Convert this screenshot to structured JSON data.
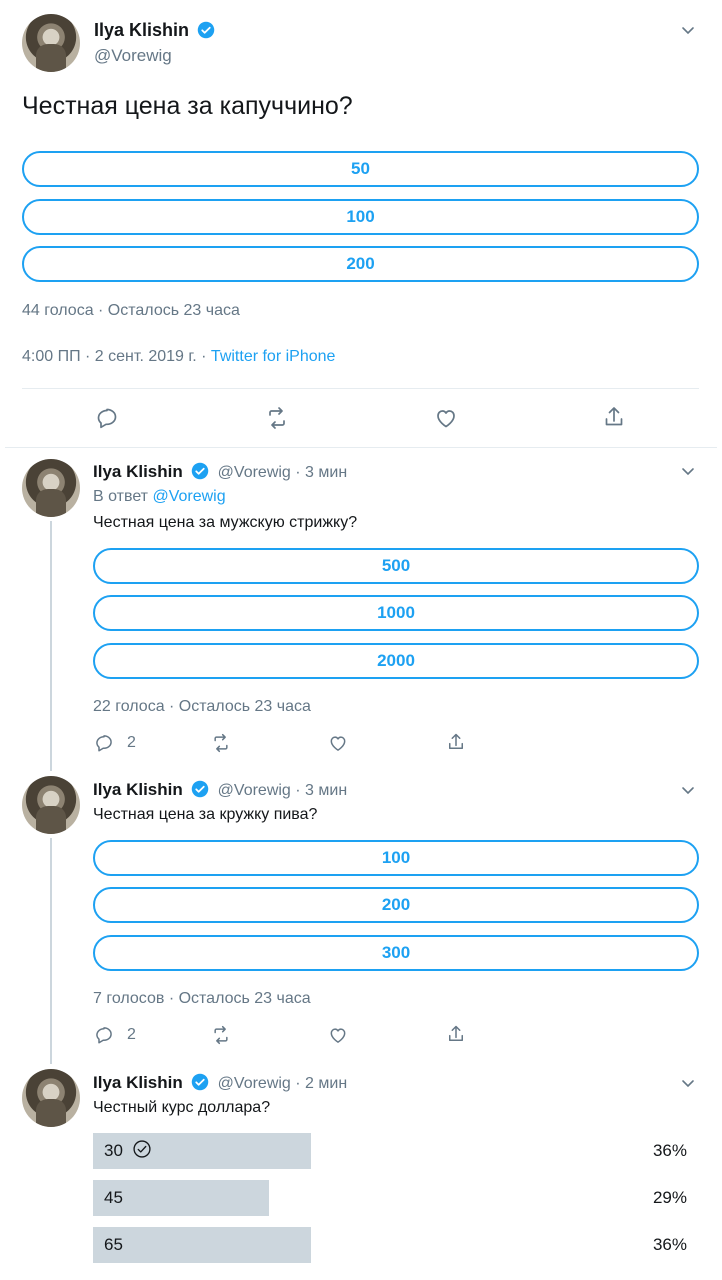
{
  "main_tweet": {
    "name": "Ilya Klishin",
    "handle": "@Vorewig",
    "text": "Честная цена за капуччино?",
    "options": [
      "50",
      "100",
      "200"
    ],
    "poll_meta": "44 голоса · Осталось 23 часа",
    "time": "4:00 ПП · 2 сент. 2019 г. · ",
    "source": "Twitter for iPhone"
  },
  "replies": [
    {
      "name": "Ilya Klishin",
      "handle": "@Vorewig · 3 мин",
      "reply_prefix": "В ответ ",
      "reply_to": "@Vorewig",
      "text": "Честная цена за мужскую стрижку?",
      "options": [
        "500",
        "1000",
        "2000"
      ],
      "poll_meta": "22 голоса · Осталось 23 часа",
      "reply_count": "2"
    },
    {
      "name": "Ilya Klishin",
      "handle": "@Vorewig · 3 мин",
      "text": "Честная цена за кружку пива?",
      "options": [
        "100",
        "200",
        "300"
      ],
      "poll_meta": "7 голосов · Осталось 23 часа",
      "reply_count": "2"
    },
    {
      "name": "Ilya Klishin",
      "handle": "@Vorewig · 2 мин",
      "text": "Честный курс доллара?",
      "results": [
        {
          "label": "30",
          "percent": "36%",
          "fraction": 0.36,
          "voted": true
        },
        {
          "label": "45",
          "percent": "29%",
          "fraction": 0.29,
          "voted": false
        },
        {
          "label": "65",
          "percent": "36%",
          "fraction": 0.36,
          "voted": false
        }
      ]
    }
  ],
  "colors": {
    "accent": "#1da1f2",
    "muted": "#657786",
    "bar": "#ccd6dd"
  }
}
